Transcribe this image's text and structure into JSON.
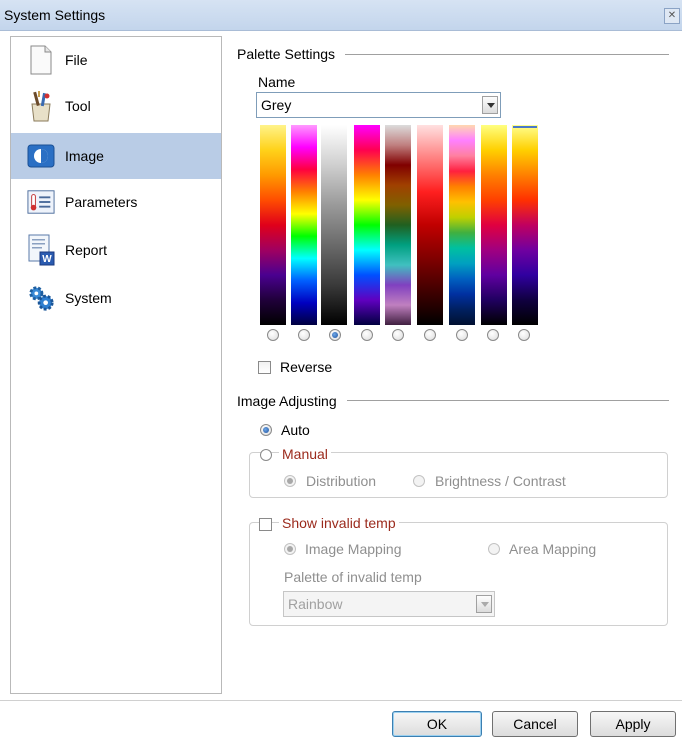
{
  "window": {
    "title": "System Settings",
    "close_label": "✕"
  },
  "sidebar": {
    "items": [
      {
        "label": "File",
        "icon": "file-icon",
        "selected": false
      },
      {
        "label": "Tool",
        "icon": "tool-icon",
        "selected": false
      },
      {
        "label": "Image",
        "icon": "image-icon",
        "selected": true
      },
      {
        "label": "Parameters",
        "icon": "parameters-icon",
        "selected": false
      },
      {
        "label": "Report",
        "icon": "report-icon",
        "selected": false
      },
      {
        "label": "System",
        "icon": "system-icon",
        "selected": false
      }
    ]
  },
  "palette_settings": {
    "section_title": "Palette Settings",
    "name_label": "Name",
    "name_value": "Grey",
    "selected_index": 2,
    "palettes": [
      {
        "name": "palette-1",
        "colors": [
          "#fff38a",
          "#ffd21a",
          "#ff9a00",
          "#ff4d00",
          "#e0001a",
          "#a00060",
          "#4a0090",
          "#20003a",
          "#000000"
        ]
      },
      {
        "name": "palette-2",
        "colors": [
          "#ff99ff",
          "#ff00ff",
          "#ff0040",
          "#ff8000",
          "#ffff00",
          "#00ff00",
          "#00ffff",
          "#0060ff",
          "#0000c0",
          "#000040"
        ]
      },
      {
        "name": "palette-3",
        "colors": [
          "#ffffff",
          "#cfcfcf",
          "#9a9a9a",
          "#6a6a6a",
          "#3a3a3a",
          "#000000"
        ]
      },
      {
        "name": "palette-4",
        "colors": [
          "#ff00ff",
          "#ff0050",
          "#ff8000",
          "#ffff00",
          "#00ff00",
          "#00ffff",
          "#0050ff",
          "#6000c0",
          "#000040"
        ]
      },
      {
        "name": "palette-5",
        "colors": [
          "#dcdcdc",
          "#c08080",
          "#800000",
          "#a04000",
          "#806000",
          "#206020",
          "#00a080",
          "#40c0c0",
          "#8040c0",
          "#c080c0",
          "#402040"
        ]
      },
      {
        "name": "palette-6",
        "colors": [
          "#ffe0e0",
          "#ff8080",
          "#ff2020",
          "#c00000",
          "#800000",
          "#400000",
          "#000000"
        ]
      },
      {
        "name": "palette-7",
        "colors": [
          "#ffd8b0",
          "#ff80ff",
          "#ff80a0",
          "#ff2040",
          "#ff8000",
          "#ffc000",
          "#c0d000",
          "#40b040",
          "#00c0a0",
          "#00a0c0",
          "#0060c0",
          "#0030a0",
          "#002060",
          "#001030"
        ]
      },
      {
        "name": "palette-8",
        "colors": [
          "#ffff80",
          "#ffd000",
          "#ff8000",
          "#ff4000",
          "#e00040",
          "#a00080",
          "#6000a0",
          "#200060",
          "#000000"
        ]
      },
      {
        "name": "palette-9",
        "colors": [
          "#ffff90",
          "#ffd000",
          "#ff8000",
          "#ff3000",
          "#c00060",
          "#7000a0",
          "#3000a0",
          "#100040",
          "#000000"
        ]
      }
    ],
    "reverse_label": "Reverse",
    "reverse_checked": false
  },
  "image_adjusting": {
    "section_title": "Image Adjusting",
    "auto_label": "Auto",
    "auto_selected": true,
    "manual_label": "Manual",
    "distribution_label": "Distribution",
    "brightness_label": "Brightness / Contrast",
    "show_invalid_label": "Show invalid temp",
    "show_invalid_checked": false,
    "image_mapping_label": "Image Mapping",
    "area_mapping_label": "Area Mapping",
    "palette_invalid_label": "Palette of invalid temp",
    "palette_invalid_value": "Rainbow"
  },
  "buttons": {
    "ok": "OK",
    "cancel": "Cancel",
    "apply": "Apply"
  },
  "colors": {
    "selected_nav_bg": "#b9cce6",
    "manual_text": "#9b2a1c"
  }
}
